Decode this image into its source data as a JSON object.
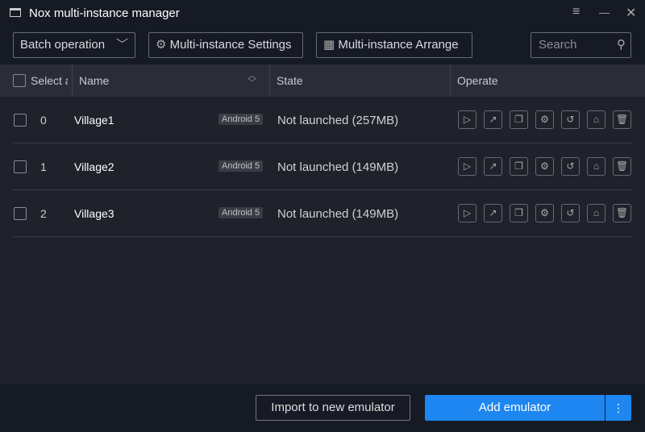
{
  "window": {
    "title": "Nox multi-instance manager",
    "menu_icon": "≡",
    "minimize_icon": "—",
    "close_icon": "✕"
  },
  "toolbar": {
    "batch": "Batch operation",
    "settings": "Multi-instance Settings",
    "arrange": "Multi-instance Arrange",
    "search_placeholder": "Search"
  },
  "table": {
    "headers": {
      "select": "Select all",
      "name": "Name",
      "state": "State",
      "operate": "Operate"
    },
    "rows": [
      {
        "index": "0",
        "name": "Village1",
        "android": "Android 5",
        "state": "Not launched (257MB)"
      },
      {
        "index": "1",
        "name": "Village2",
        "android": "Android 5",
        "state": "Not launched (149MB)"
      },
      {
        "index": "2",
        "name": "Village3",
        "android": "Android 5",
        "state": "Not launched (149MB)"
      }
    ],
    "operate_icons": [
      "play-icon",
      "shortcut-icon",
      "copy-icon",
      "settings-icon",
      "backup-icon",
      "clean-icon",
      "delete-icon"
    ]
  },
  "footer": {
    "import": "Import to new emulator",
    "add": "Add emulator",
    "more": "⋮"
  },
  "colors": {
    "accent": "#1e86f0"
  }
}
